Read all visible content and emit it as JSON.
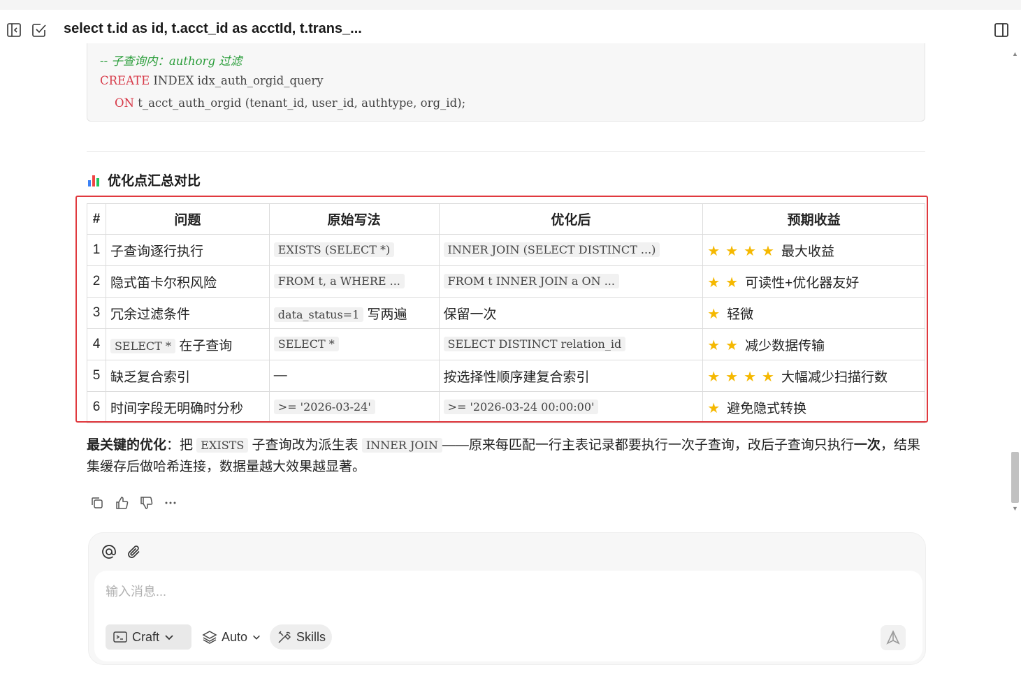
{
  "header": {
    "title": "select t.id as id, t.acct_id as acctId, t.trans_..."
  },
  "code_block": {
    "comment": "-- 子查询内：authorg 过滤",
    "line2_kw": "CREATE",
    "line2_rest": " INDEX idx_auth_orgid_query",
    "line3_indent": "    ",
    "line3_kw": "ON",
    "line3_rest": " t_acct_auth_orgid (tenant_id, user_id, authtype, org_id);"
  },
  "section": {
    "title": "优化点汇总对比"
  },
  "table": {
    "headers": [
      "#",
      "问题",
      "原始写法",
      "优化后",
      "预期收益"
    ],
    "rows": [
      {
        "num": "1",
        "issue": "子查询逐行执行",
        "orig_code": "EXISTS (SELECT *)",
        "orig_text": "",
        "opt_code": "INNER JOIN (SELECT DISTINCT ...)",
        "opt_text": "",
        "stars": 4,
        "benefit": "最大收益"
      },
      {
        "num": "2",
        "issue": "隐式笛卡尔积风险",
        "orig_code": "FROM t, a WHERE ...",
        "orig_text": "",
        "opt_code": "FROM t INNER JOIN a ON ...",
        "opt_text": "",
        "stars": 2,
        "benefit": "可读性+优化器友好"
      },
      {
        "num": "3",
        "issue": "冗余过滤条件",
        "orig_code": "data_status=1",
        "orig_text": " 写两遍",
        "opt_code": "",
        "opt_text": "保留一次",
        "stars": 1,
        "benefit": "轻微"
      },
      {
        "num": "4",
        "issue_code": "SELECT *",
        "issue": " 在子查询",
        "orig_code": "SELECT *",
        "orig_text": "",
        "opt_code": "SELECT DISTINCT relation_id",
        "opt_text": "",
        "stars": 2,
        "benefit": "减少数据传输"
      },
      {
        "num": "5",
        "issue": "缺乏复合索引",
        "orig_code": "",
        "orig_text": "—",
        "opt_code": "",
        "opt_text": "按选择性顺序建复合索引",
        "stars": 4,
        "benefit": "大幅减少扫描行数"
      },
      {
        "num": "6",
        "issue": "时间字段无明确时分秒",
        "orig_code": ">= '2026-03-24'",
        "orig_text": "",
        "opt_code": ">= '2026-03-24 00:00:00'",
        "opt_text": "",
        "stars": 1,
        "benefit": "避免隐式转换"
      }
    ]
  },
  "summary": {
    "bold_lead": "最关键的优化",
    "t1": "：把 ",
    "code1": "EXISTS",
    "t2": " 子查询改为派生表 ",
    "code2": "INNER JOIN",
    "t3": "——原来每匹配一行主表记录都要执行一次子查询，改后子查询只执行",
    "bold2": "一次",
    "t4": "，结果集缓存后做哈希连接，数据量越大效果越显著。"
  },
  "composer": {
    "placeholder": "输入消息...",
    "mode_label": "Craft",
    "model_label": "Auto",
    "skills_label": "Skills"
  },
  "colors": {
    "highlight_border": "#e0393e",
    "star": "#f5b800",
    "code_keyword": "#d73a49",
    "code_comment": "#2a9d3a"
  }
}
